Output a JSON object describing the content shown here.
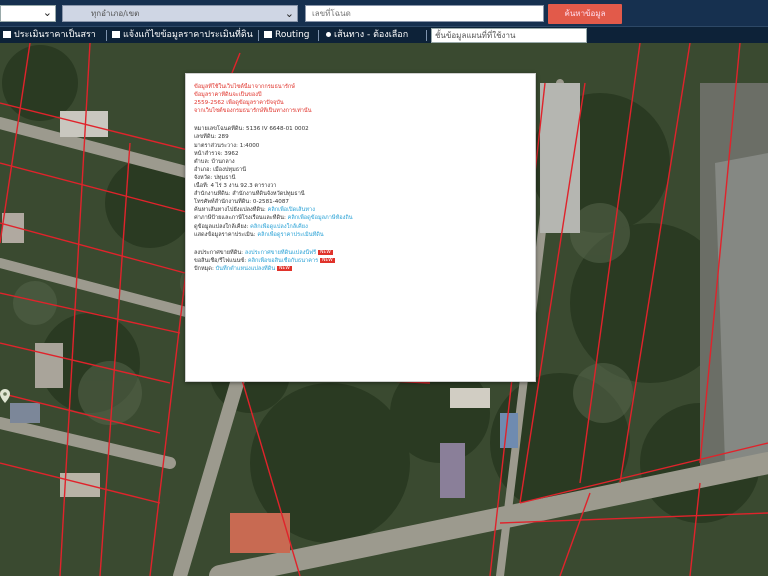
{
  "topbar": {
    "province_select": "",
    "district_select": "ทุกอำเภอ/เขต",
    "search_placeholder": "เลขที่โฉนด",
    "search_button": "ค้นหาข้อมูล"
  },
  "menubar": {
    "items": [
      "ประเมินราคาเป็นสรา",
      "แจ้งแก้ไขข้อมูลราคาประเมินที่ดิน",
      "Routing",
      "เส้นทาง - ต้องเลือก"
    ],
    "layer_input_placeholder": "ชั้นข้อมูลแผนที่ที่ใช้งาน"
  },
  "popup": {
    "warnings": [
      "ข้อมูลที่ใช้ในเว็บไซต์นี้มาจากกรมธนารักษ์",
      "ข้อมูลราคาที่ดินจะเป็นของปี",
      "2559-2562 เพื่อดูข้อมูลราคาปัจจุบัน",
      "จากเว็บไซต์ของกรมธนารักษ์ที่เป็นทางการเท่านั้น"
    ],
    "details": [
      {
        "label": "หมายเลขโฉนดที่ดิน:",
        "value": "5136 IV 6648-01 0002"
      },
      {
        "label": "เลขที่ดิน:",
        "value": "289"
      },
      {
        "label": "มาตราส่วนระวาง:",
        "value": "1:4000"
      },
      {
        "label": "หน้าสำรวจ:",
        "value": "3962"
      },
      {
        "label": "ตำบล:",
        "value": "บ้านกลาง"
      },
      {
        "label": "อำเภอ:",
        "value": "เมืองปทุมธานี"
      },
      {
        "label": "จังหวัด:",
        "value": "ปทุมธานี"
      },
      {
        "label": "เนื้อที่:",
        "value": "4 ไร่ 3 งาน 92.3 ตารางวา"
      },
      {
        "label": "สำนักงานที่ดิน:",
        "value": "สำนักงานที่ดินจังหวัดปทุมธานี"
      },
      {
        "label": "โทรศัพท์สำนักงานที่ดิน:",
        "value": "0-2581-4087"
      }
    ],
    "link_rows": [
      {
        "label": "ค้นหาเส้นทางไปยังแปลงที่ดิน:",
        "link": "คลิกเพื่อเปิดเส้นทาง"
      },
      {
        "label": "ค่าภาษีป้ายและภาษีโรงเรือนและที่ดิน:",
        "link": "คลิกเพื่อดูข้อมูลภาษีท้องถิ่น"
      },
      {
        "label": "ดูข้อมูลแปลงใกล้เคียง:",
        "link": "คลิกเพื่อดูแปลงใกล้เคียง"
      },
      {
        "label": "แสดงข้อมูลราคาประเมิน:",
        "link": "คลิกเพื่อดูราคาประเมินที่ดิน"
      }
    ],
    "bottom_rows": [
      {
        "label": "ลงประกาศขายที่ดิน:",
        "link": "ลงประกาศขายที่ดินแปลงนี้ฟรี",
        "badge": "NEW"
      },
      {
        "label": "ขอสินเชื่อ/รีไฟแนนซ์:",
        "link": "คลิกเพื่อขอสินเชื่อกับธนาคาร",
        "badge": "NEW"
      },
      {
        "label": "ปักหมุด:",
        "link": "บันทึกตำแหน่งแปลงที่ดิน",
        "badge": "NEW"
      }
    ]
  },
  "colors": {
    "topbar": "#16304f",
    "menubar": "#0d2238",
    "button": "#e25a4a",
    "parcel_line": "#e0232b",
    "warning_text": "#e0332b",
    "link_text": "#2aa2d6"
  }
}
